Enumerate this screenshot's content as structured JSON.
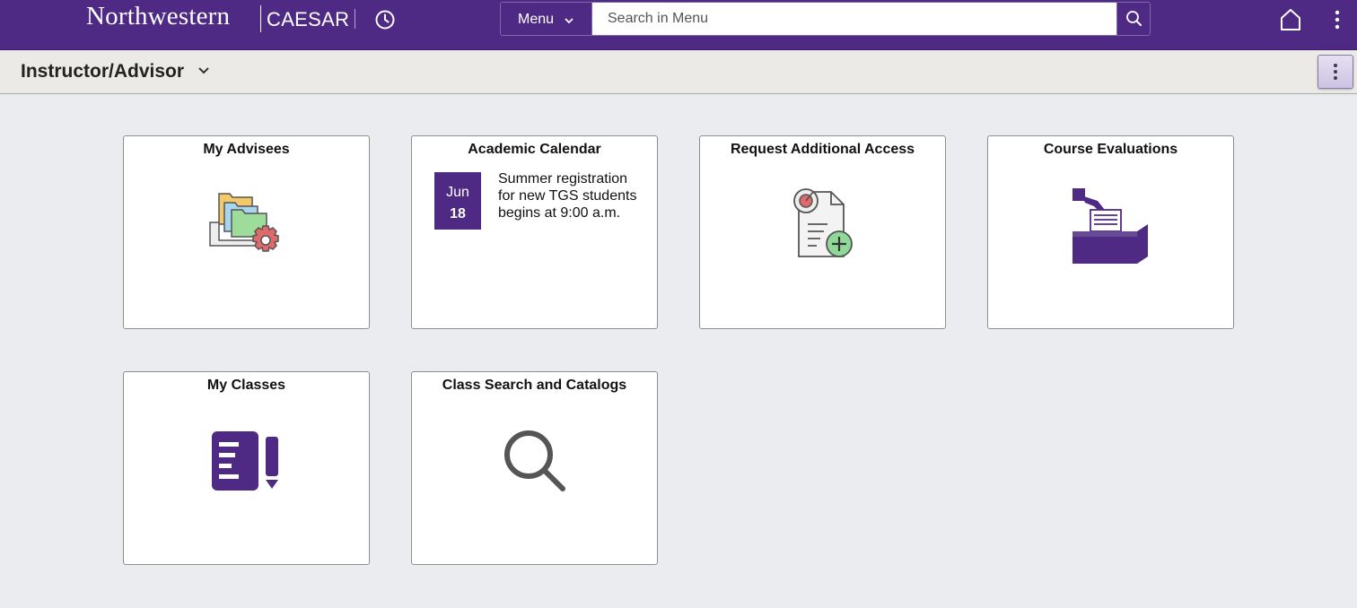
{
  "header": {
    "brand_name": "Northwestern",
    "app_name": "CAESAR",
    "menu_label": "Menu",
    "search_placeholder": "Search in Menu",
    "icons": [
      "history-icon",
      "chevron-down-icon",
      "search-icon",
      "home-icon",
      "more-vertical-icon"
    ]
  },
  "subheader": {
    "title": "Instructor/Advisor",
    "icons": [
      "chevron-down-icon",
      "more-vertical-icon"
    ]
  },
  "tiles": [
    {
      "title": "My Advisees",
      "icon": "folders-gear-icon"
    },
    {
      "title": "Academic Calendar",
      "calendar": {
        "month": "Jun",
        "day": "18",
        "event": "Summer registration for new TGS students begins at 9:00 a.m."
      }
    },
    {
      "title": "Request Additional Access",
      "icon": "document-add-icon"
    },
    {
      "title": "Course Evaluations",
      "icon": "ballot-box-icon"
    },
    {
      "title": "My Classes",
      "icon": "notes-pencil-icon"
    },
    {
      "title": "Class Search and Catalogs",
      "icon": "magnifier-icon"
    }
  ],
  "colors": {
    "brand_purple": "#4e2a84",
    "page_background": "#ebecef",
    "subheader_background": "#eceae6"
  }
}
